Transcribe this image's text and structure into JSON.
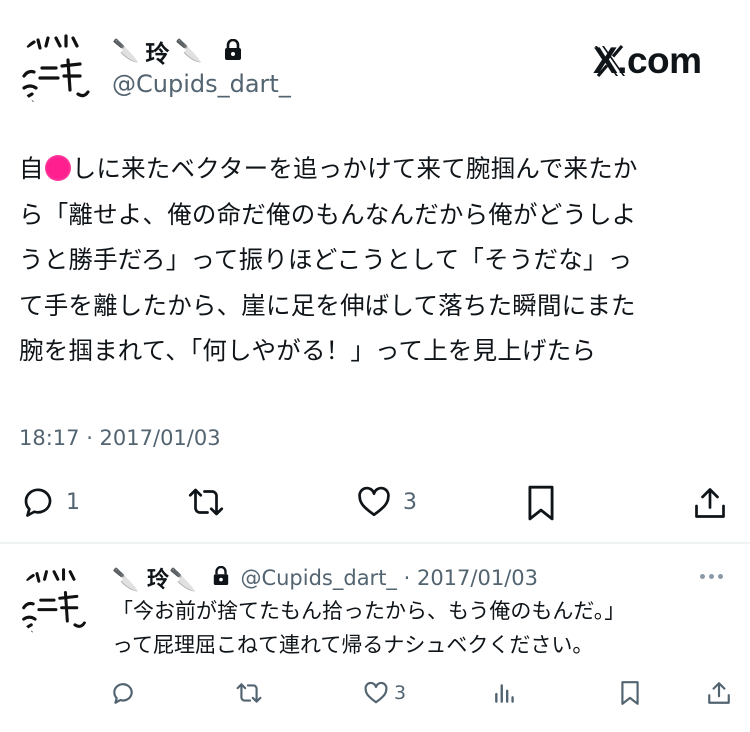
{
  "main_tweet": {
    "display_name": "玲",
    "display_name_decorated": "🔪 玲🔪",
    "handle": "@Cupids_dart_",
    "brand": "X.com",
    "text_prefix": "自",
    "text_body": "しに来たベクターを追っかけて来て腕掴んで来たか\nら「離せよ、俺の命だ俺のもんなんだから俺がどうしよ\nうと勝手だろ」って振りほどこうとして「そうだな」っ\nて手を離したから、崖に足を伸ばして落ちた瞬間にまた\n腕を掴まれて、「何しやがる！」って上を見上げたら",
    "timestamp": "18:17 · 2017/01/03",
    "actions": {
      "reply_count": "1",
      "retweet_count": "",
      "like_count": "3"
    }
  },
  "reply_tweet": {
    "display_name": "🔪 玲🔪",
    "handle_date": "@Cupids_dart_ · 2017/01/03",
    "text": "「今お前が捨てたもん拾ったから、もう俺のもんだ。」\nって屁理屈こねて連れて帰るナシュベクください。",
    "actions": {
      "like_count": "3"
    }
  },
  "colors": {
    "text": "#0f1419",
    "muted": "#536471",
    "divider": "#eff3f4",
    "redaction": "#ff1f8f"
  },
  "icons": [
    "lock-icon",
    "knife-icon",
    "reply-icon",
    "retweet-icon",
    "like-icon",
    "bookmark-icon",
    "share-icon",
    "views-icon",
    "more-icon"
  ]
}
